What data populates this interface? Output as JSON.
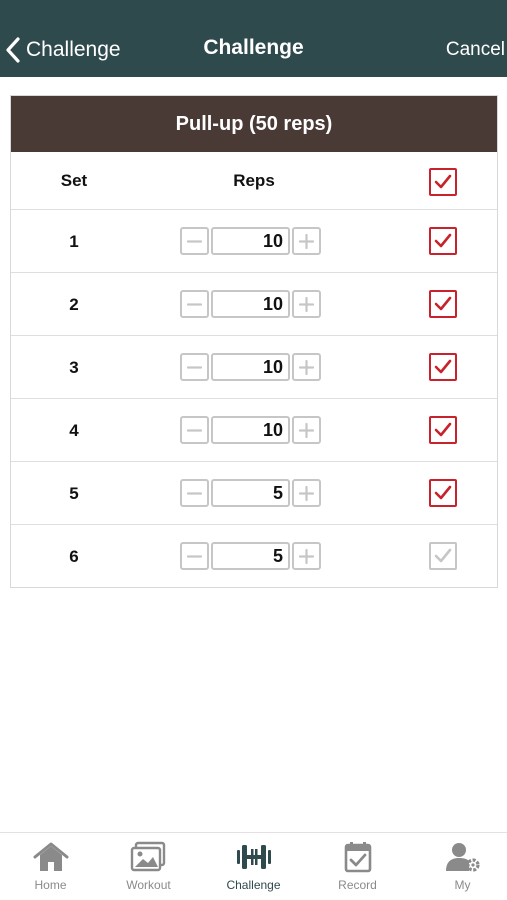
{
  "colors": {
    "navbar": "#2f4a4d",
    "card_header": "#4a3a36",
    "checked": "#c8232c",
    "unchecked": "#c6c6c6",
    "tab_active": "#2f4a4d",
    "tab_inactive": "#8a8a8a"
  },
  "navbar": {
    "back_label": "Challenge",
    "title": "Challenge",
    "cancel_label": "Cancel"
  },
  "card": {
    "title": "Pull-up (50 reps)",
    "col_set": "Set",
    "col_reps": "Reps",
    "header_checked": true,
    "rows": [
      {
        "set": "1",
        "reps": "10",
        "checked": true
      },
      {
        "set": "2",
        "reps": "10",
        "checked": true
      },
      {
        "set": "3",
        "reps": "10",
        "checked": true
      },
      {
        "set": "4",
        "reps": "10",
        "checked": true
      },
      {
        "set": "5",
        "reps": "5",
        "checked": true
      },
      {
        "set": "6",
        "reps": "5",
        "checked": false
      }
    ]
  },
  "tabbar": {
    "items": [
      {
        "label": "Home",
        "icon": "home-icon",
        "active": false
      },
      {
        "label": "Workout",
        "icon": "photo-gallery-icon",
        "active": false
      },
      {
        "label": "Challenge",
        "icon": "dumbbell-icon",
        "active": true
      },
      {
        "label": "Record",
        "icon": "calendar-check-icon",
        "active": false
      },
      {
        "label": "My",
        "icon": "user-settings-icon",
        "active": false
      }
    ]
  }
}
